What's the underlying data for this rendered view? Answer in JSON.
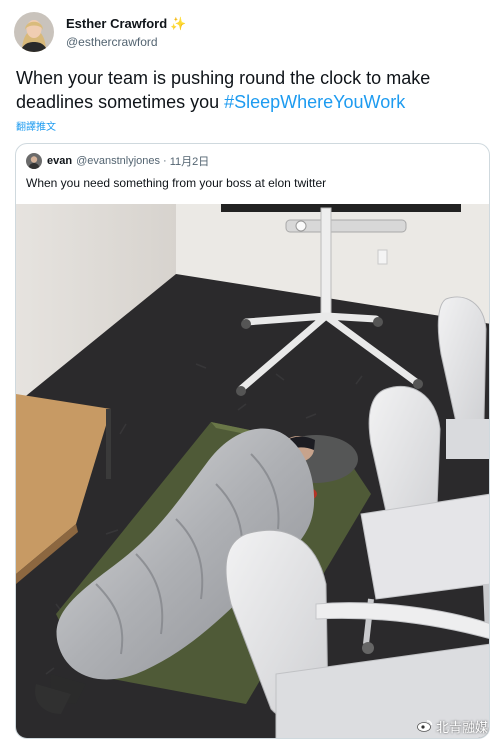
{
  "tweet": {
    "author": {
      "name": "Esther Crawford",
      "handle": "@esthercrawford",
      "badge_icon": "sparkle-icon"
    },
    "text_before": "When your team is pushing round the clock to make deadlines sometimes you ",
    "hashtag": "#SleepWhereYouWork",
    "translate_label": "翻譯推文"
  },
  "quoted_tweet": {
    "author_name": "evan",
    "author_handle": "@evanstnlyjones",
    "separator": "·",
    "date": "11月2日",
    "text": "When you need something from your boss at elon twitter",
    "image_icon": "office-sleeping-bag-photo"
  },
  "watermark": {
    "label": "北青融媒",
    "icon": "weibo-icon"
  },
  "colors": {
    "link": "#1d9bf0",
    "secondary_text": "#536471",
    "border": "#cfd9de",
    "sparkle": "#f5b914"
  }
}
